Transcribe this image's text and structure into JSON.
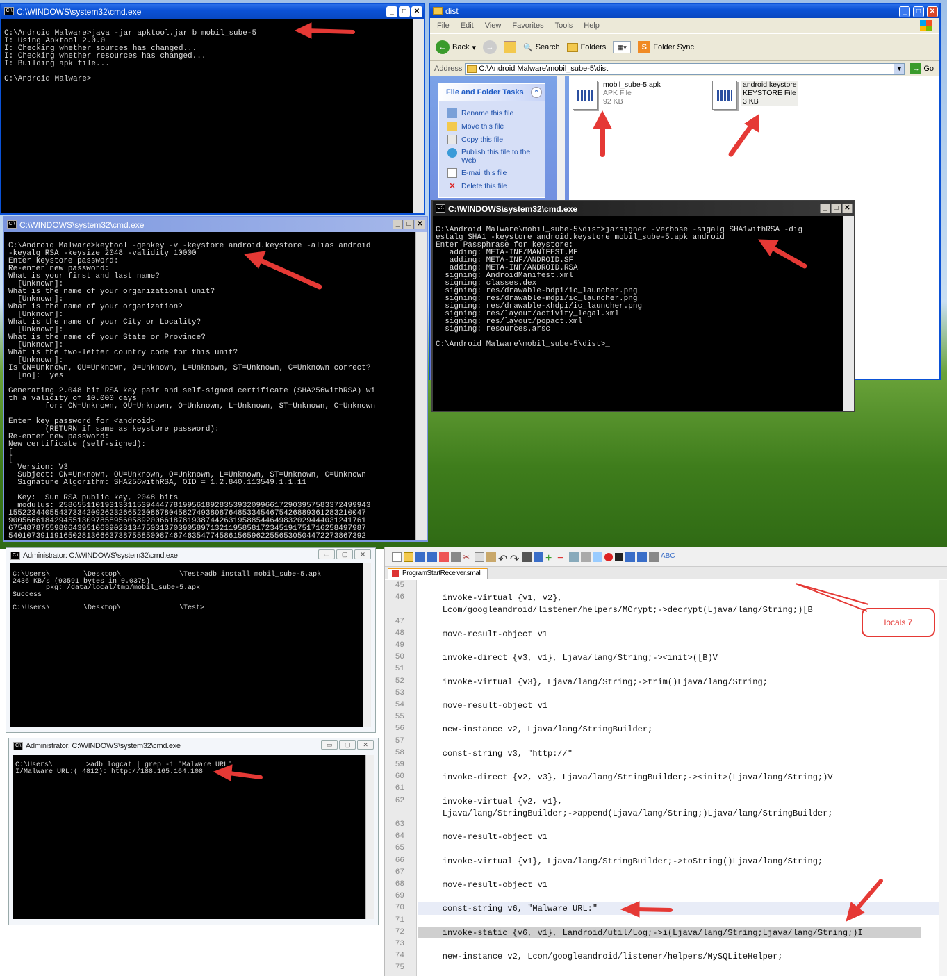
{
  "desktop": {
    "colors": {
      "sky": "#9fc0e8",
      "grass": "#3f7d1c"
    }
  },
  "cmd_build": {
    "title": "C:\\WINDOWS\\system32\\cmd.exe",
    "output": "C:\\Android Malware>java -jar apktool.jar b mobil_sube-5\nI: Using Apktool 2.0.0\nI: Checking whether sources has changed...\nI: Checking whether resources has changed...\nI: Building apk file...\n\nC:\\Android Malware>"
  },
  "explorer": {
    "title": "dist",
    "menu": [
      "File",
      "Edit",
      "View",
      "Favorites",
      "Tools",
      "Help"
    ],
    "toolbar": {
      "back": "Back",
      "search": "Search",
      "folders": "Folders",
      "folder_sync": "Folder Sync"
    },
    "address_label": "Address",
    "address_value": "C:\\Android Malware\\mobil_sube-5\\dist",
    "go_label": "Go",
    "tasks_title": "File and Folder Tasks",
    "tasks": [
      "Rename this file",
      "Move this file",
      "Copy this file",
      "Publish this file to the Web",
      "E-mail this file",
      "Delete this file"
    ],
    "files": [
      {
        "name": "mobil_sube-5.apk",
        "type": "APK File",
        "size": "92 KB"
      },
      {
        "name": "android.keystore",
        "type": "KEYSTORE File",
        "size": "3 KB"
      }
    ]
  },
  "cmd_keytool": {
    "title": "C:\\WINDOWS\\system32\\cmd.exe",
    "output": "C:\\Android Malware>keytool -genkey -v -keystore android.keystore -alias android\n-keyalg RSA -keysize 2048 -validity 10000\nEnter keystore password:\nRe-enter new password:\nWhat is your first and last name?\n  [Unknown]:\nWhat is the name of your organizational unit?\n  [Unknown]:\nWhat is the name of your organization?\n  [Unknown]:\nWhat is the name of your City or Locality?\n  [Unknown]:\nWhat is the name of your State or Province?\n  [Unknown]:\nWhat is the two-letter country code for this unit?\n  [Unknown]:\nIs CN=Unknown, OU=Unknown, O=Unknown, L=Unknown, ST=Unknown, C=Unknown correct?\n  [no]:  yes\n\nGenerating 2.048 bit RSA key pair and self-signed certificate (SHA256withRSA) wi\nth a validity of 10.000 days\n        for: CN=Unknown, OU=Unknown, O=Unknown, L=Unknown, ST=Unknown, C=Unknown\n\nEnter key password for <android>\n        (RETURN if same as keystore password):\nRe-enter new password:\nNew certificate (self-signed):\n[\n[\n  Version: V3\n  Subject: CN=Unknown, OU=Unknown, O=Unknown, L=Unknown, ST=Unknown, C=Unknown\n  Signature Algorithm: SHA256withRSA, OID = 1.2.840.113549.1.1.11\n\n  Key:  Sun RSA public key, 2048 bits\n  modulus: 25865511019313311539444778199561892835393209966172903957583372499943\n155223440554373342092623266523086780458274938087648533454675426889361283210047\n900566618429455130978589560589200661878193874426319588544649832029444031241761\n675487875598964395106390231347503137039058971321195858172345191751716258497987\n540107391191650281366637387558500874674635477458615659622556530504472273867392"
  },
  "cmd_jarsigner": {
    "title": "C:\\WINDOWS\\system32\\cmd.exe",
    "output": "C:\\Android Malware\\mobil_sube-5\\dist>jarsigner -verbose -sigalg SHA1withRSA -dig\nestalg SHA1 -keystore android.keystore mobil_sube-5.apk android\nEnter Passphrase for keystore:\n   adding: META-INF/MANIFEST.MF\n   adding: META-INF/ANDROID.SF\n   adding: META-INF/ANDROID.RSA\n  signing: AndroidManifest.xml\n  signing: classes.dex\n  signing: res/drawable-hdpi/ic_launcher.png\n  signing: res/drawable-mdpi/ic_launcher.png\n  signing: res/drawable-xhdpi/ic_launcher.png\n  signing: res/layout/activity_legal.xml\n  signing: res/layout/popact.xml\n  signing: resources.arsc\n\nC:\\Android Malware\\mobil_sube-5\\dist>_"
  },
  "cmd_adb_install": {
    "title": "Administrator: C:\\WINDOWS\\system32\\cmd.exe",
    "output": "C:\\Users\\        \\Desktop\\              \\Test>adb install mobil_sube-5.apk\n2436 KB/s (93591 bytes in 0.037s)\n        pkg: /data/local/tmp/mobil_sube-5.apk\nSuccess\n\nC:\\Users\\        \\Desktop\\              \\Test>"
  },
  "cmd_logcat": {
    "title": "Administrator: C:\\WINDOWS\\system32\\cmd.exe",
    "output": "C:\\Users\\        >adb logcat | grep -i \"Malware URL\"\nI/Malware URL:( 4812): http://188.165.164.108"
  },
  "editor": {
    "tab": "ProgramStartReceiver.smali",
    "callout": "locals 7",
    "lines": [
      {
        "n": "45",
        "t": ""
      },
      {
        "n": "46",
        "t": "    invoke-virtual {v1, v2},"
      },
      {
        "n": "",
        "t": "    Lcom/googleandroid/listener/helpers/MCrypt;->decrypt(Ljava/lang/String;)[B"
      },
      {
        "n": "47",
        "t": ""
      },
      {
        "n": "48",
        "t": "    move-result-object v1"
      },
      {
        "n": "49",
        "t": ""
      },
      {
        "n": "50",
        "t": "    invoke-direct {v3, v1}, Ljava/lang/String;-><init>([B)V"
      },
      {
        "n": "51",
        "t": ""
      },
      {
        "n": "52",
        "t": "    invoke-virtual {v3}, Ljava/lang/String;->trim()Ljava/lang/String;"
      },
      {
        "n": "53",
        "t": ""
      },
      {
        "n": "54",
        "t": "    move-result-object v1"
      },
      {
        "n": "55",
        "t": ""
      },
      {
        "n": "56",
        "t": "    new-instance v2, Ljava/lang/StringBuilder;"
      },
      {
        "n": "57",
        "t": ""
      },
      {
        "n": "58",
        "t": "    const-string v3, \"http://\""
      },
      {
        "n": "59",
        "t": ""
      },
      {
        "n": "60",
        "t": "    invoke-direct {v2, v3}, Ljava/lang/StringBuilder;-><init>(Ljava/lang/String;)V"
      },
      {
        "n": "61",
        "t": ""
      },
      {
        "n": "62",
        "t": "    invoke-virtual {v2, v1},"
      },
      {
        "n": "",
        "t": "    Ljava/lang/StringBuilder;->append(Ljava/lang/String;)Ljava/lang/StringBuilder;"
      },
      {
        "n": "63",
        "t": ""
      },
      {
        "n": "64",
        "t": "    move-result-object v1"
      },
      {
        "n": "65",
        "t": ""
      },
      {
        "n": "66",
        "t": "    invoke-virtual {v1}, Ljava/lang/StringBuilder;->toString()Ljava/lang/String;"
      },
      {
        "n": "67",
        "t": ""
      },
      {
        "n": "68",
        "t": "    move-result-object v1"
      },
      {
        "n": "69",
        "t": ""
      },
      {
        "n": "70",
        "t": "    const-string v6, \"Malware URL:\""
      },
      {
        "n": "71",
        "t": ""
      },
      {
        "n": "72",
        "t": "    invoke-static {v6, v1}, Landroid/util/Log;->i(Ljava/lang/String;Ljava/lang/String;)I"
      },
      {
        "n": "73",
        "t": ""
      },
      {
        "n": "74",
        "t": "    new-instance v2, Lcom/googleandroid/listener/helpers/MySQLiteHelper;"
      },
      {
        "n": "75",
        "t": ""
      }
    ]
  }
}
